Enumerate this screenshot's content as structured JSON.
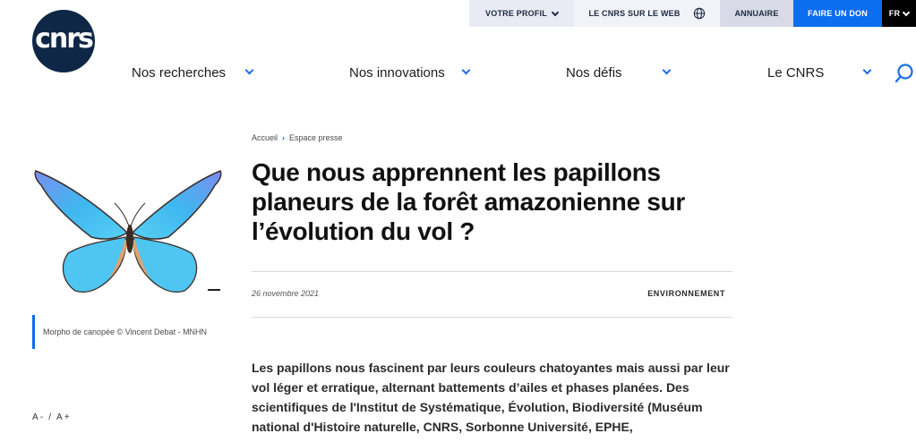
{
  "topbar": {
    "profil": "VOTRE PROFIL",
    "web": "LE CNRS SUR LE WEB",
    "annuaire": "ANNUAIRE",
    "don": "FAIRE UN DON",
    "lang": "FR"
  },
  "logo": {
    "text": "cnrs"
  },
  "nav": {
    "items": [
      "Nos recherches",
      "Nos innovations",
      "Nos défis",
      "Le CNRS"
    ]
  },
  "breadcrumb": {
    "home": "Accueil",
    "section": "Espace presse"
  },
  "article": {
    "title": "Que nous apprennent les papillons planeurs de la forêt amazonienne sur l’évolution du vol ?",
    "date": "26 novembre 2021",
    "category": "ENVIRONNEMENT",
    "intro": "Les papillons nous fascinent par leurs couleurs chatoyantes mais aussi par leur vol léger et erratique, alternant battements d’ailes et phases planées. Des scientifiques de l'Institut de Systématique, Évolution, Biodiversité (Muséum national d'Histoire naturelle, CNRS, Sorbonne Université, EPHE,"
  },
  "image": {
    "caption": "Morpho de canopée © Vincent Debat - MNHN"
  },
  "font_controls": {
    "decrease": "A -",
    "sep": "/",
    "increase": "A +"
  },
  "colors": {
    "accent": "#0b6df0",
    "logo_bg": "#0e2747"
  }
}
